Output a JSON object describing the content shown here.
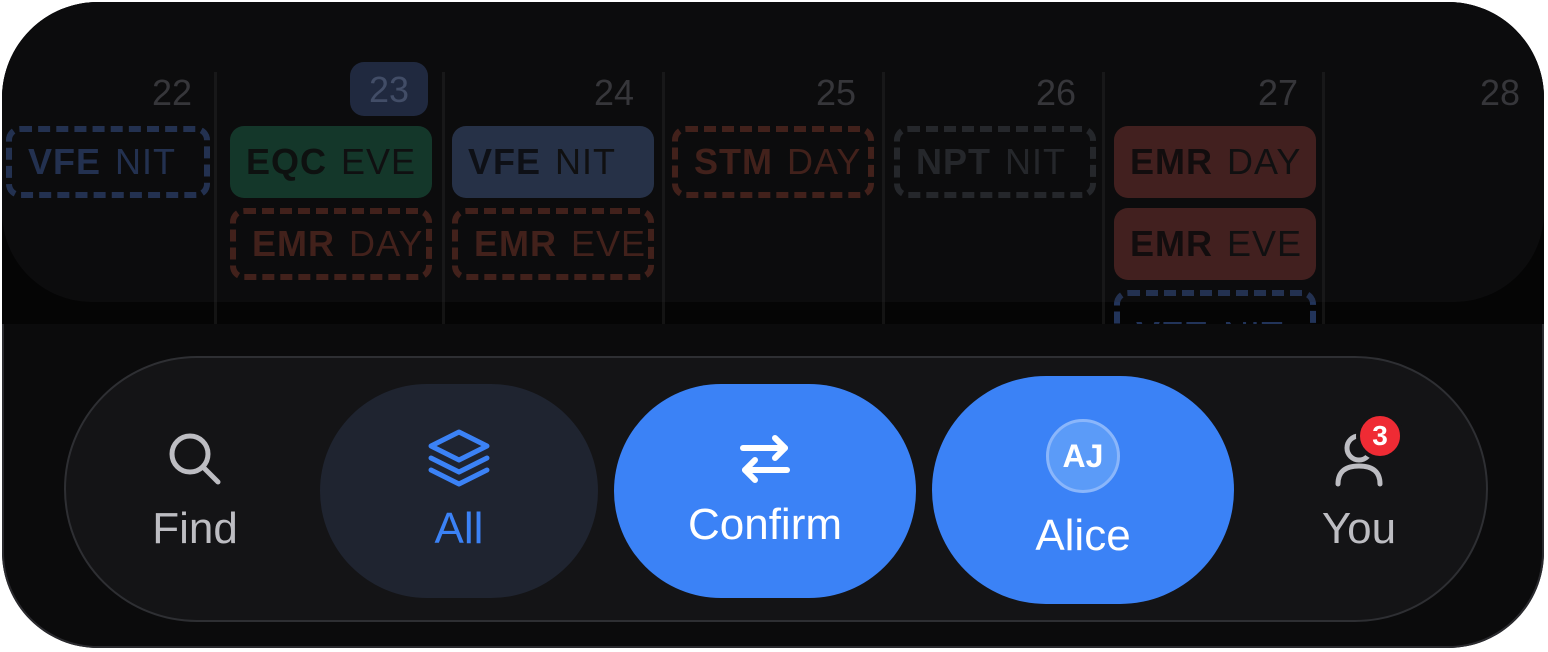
{
  "calendar": {
    "days": [
      "22",
      "23",
      "24",
      "25",
      "26",
      "27",
      "28"
    ],
    "today": "23",
    "events": {
      "d22": [
        {
          "code": "VFE",
          "shift": "NIT",
          "style": "dashed-blue"
        }
      ],
      "d23": [
        {
          "code": "EQC",
          "shift": "EVE",
          "style": "solid-green"
        },
        {
          "code": "EMR",
          "shift": "DAY",
          "style": "dashed-red"
        }
      ],
      "d24": [
        {
          "code": "VFE",
          "shift": "NIT",
          "style": "solid-blue"
        },
        {
          "code": "EMR",
          "shift": "EVE",
          "style": "dashed-red"
        }
      ],
      "d25": [
        {
          "code": "STM",
          "shift": "DAY",
          "style": "dashed-red"
        }
      ],
      "d26": [
        {
          "code": "NPT",
          "shift": "NIT",
          "style": "dashed-gray"
        }
      ],
      "d27": [
        {
          "code": "EMR",
          "shift": "DAY",
          "style": "solid-red"
        },
        {
          "code": "EMR",
          "shift": "EVE",
          "style": "solid-red"
        },
        {
          "code": "VFE",
          "shift": "NIT",
          "style": "dashed-blue"
        }
      ]
    }
  },
  "tabbar": {
    "find": {
      "label": "Find",
      "icon": "search-icon"
    },
    "all": {
      "label": "All",
      "icon": "layers-icon"
    },
    "confirm": {
      "label": "Confirm",
      "icon": "swap-arrows-icon"
    },
    "alice": {
      "label": "Alice",
      "initials": "AJ"
    },
    "you": {
      "label": "You",
      "icon": "person-icon",
      "badge": "3"
    }
  },
  "colors": {
    "accent": "#3b82f6",
    "badge": "#ef2b34",
    "pill_dark": "#1f2430"
  }
}
